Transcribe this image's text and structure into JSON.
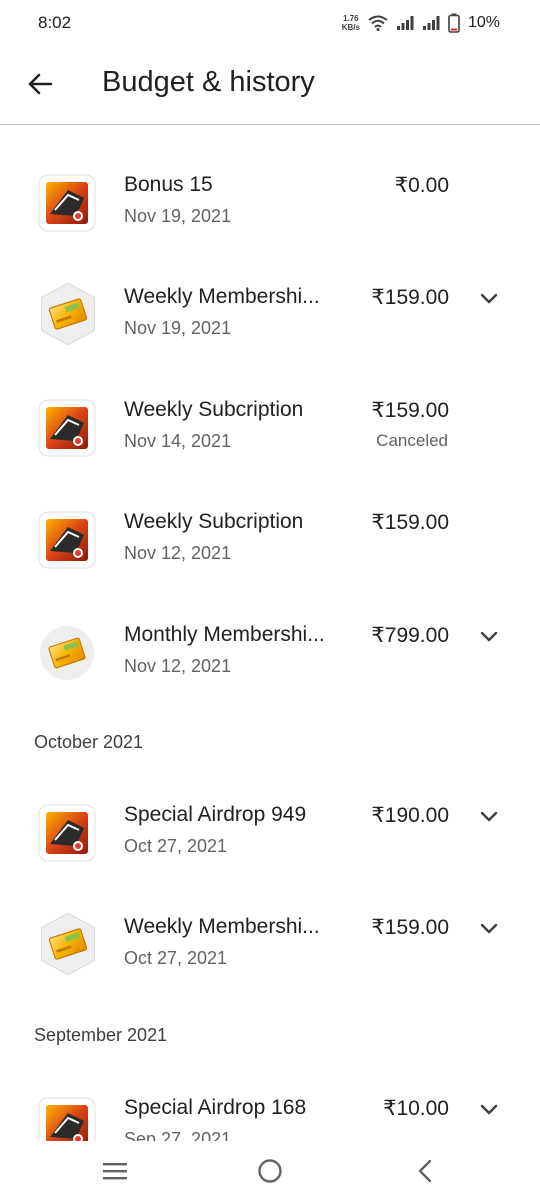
{
  "status_bar": {
    "time": "8:02",
    "net_speed_value": "1.76",
    "net_speed_unit": "KB/s",
    "battery": "10%"
  },
  "header": {
    "title": "Budget & history"
  },
  "items": [
    {
      "name": "Bonus 15",
      "date": "Nov 19, 2021",
      "price": "₹0.00",
      "status": "",
      "icon": "game-icon",
      "expandable": false
    },
    {
      "name": "Weekly Membershi...",
      "date": "Nov 19, 2021",
      "price": "₹159.00",
      "status": "",
      "icon": "membership-card-icon",
      "expandable": true
    },
    {
      "name": "Weekly Subcription",
      "date": "Nov 14, 2021",
      "price": "₹159.00",
      "status": "Canceled",
      "icon": "game-icon",
      "expandable": false
    },
    {
      "name": "Weekly Subcription",
      "date": "Nov 12, 2021",
      "price": "₹159.00",
      "status": "",
      "icon": "game-icon",
      "expandable": false
    },
    {
      "name": "Monthly Membershi...",
      "date": "Nov 12, 2021",
      "price": "₹799.00",
      "status": "",
      "icon": "membership-card-icon",
      "expandable": true
    },
    {
      "name": "Special Airdrop 949",
      "date": "Oct 27, 2021",
      "price": "₹190.00",
      "status": "",
      "icon": "game-icon",
      "expandable": true
    },
    {
      "name": "Weekly Membershi...",
      "date": "Oct 27, 2021",
      "price": "₹159.00",
      "status": "",
      "icon": "membership-card-icon",
      "expandable": true
    },
    {
      "name": "Special Airdrop 168",
      "date": "Sep 27, 2021",
      "price": "₹10.00",
      "status": "",
      "icon": "game-icon",
      "expandable": true
    }
  ],
  "sections": {
    "october": "October 2021",
    "september": "September 2021"
  },
  "nav": {
    "items": [
      "recents-icon",
      "home-icon",
      "back-icon"
    ]
  },
  "colors": {
    "text_primary": "#202124",
    "text_secondary": "#5f6368",
    "divider": "#c4c7c5"
  }
}
